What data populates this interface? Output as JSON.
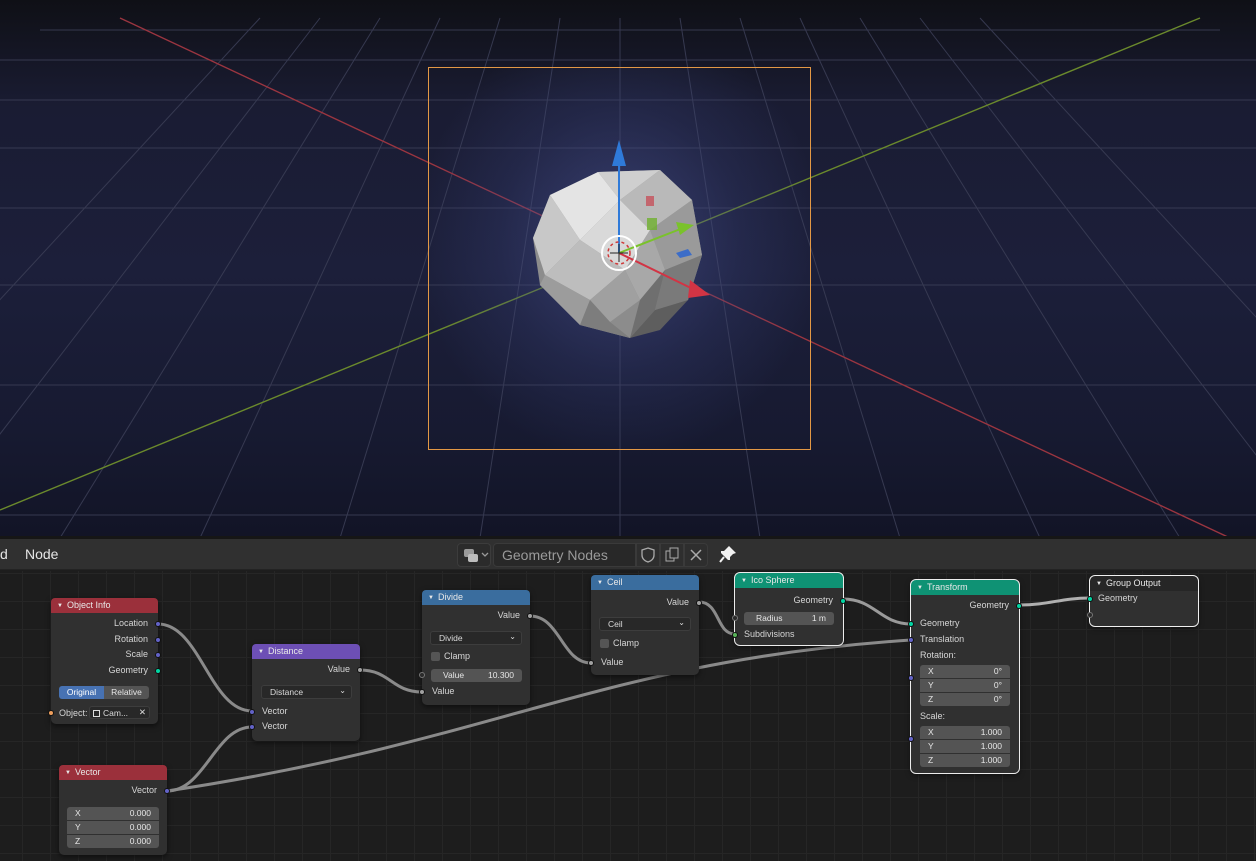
{
  "header": {
    "menu_partial": "d",
    "menu_node": "Node",
    "tree_name_placeholder": "Geometry Nodes",
    "fake_user_icon": "shield-icon",
    "copy_icon": "duplicate-icon",
    "close_icon": "close-icon",
    "pin_icon": "pin-icon"
  },
  "colors": {
    "camera_frame": "#e39845",
    "geometry_socket": "#00d6a3",
    "vector_socket": "#6363c7",
    "value_socket": "#a1a1a1",
    "input_header": "#9b303b",
    "vector_header": "#6d4fb5",
    "math_header": "#3a6d9e",
    "geometry_header": "#0f9274"
  },
  "nodes": {
    "object_info": {
      "title": "Object Info",
      "outputs": [
        "Location",
        "Rotation",
        "Scale",
        "Geometry"
      ],
      "mode_original": "Original",
      "mode_relative": "Relative",
      "object_label": "Object:",
      "object_value": "Cam..."
    },
    "distance": {
      "title": "Distance",
      "output": "Value",
      "operation": "Distance",
      "inputs": [
        "Vector",
        "Vector"
      ]
    },
    "divide": {
      "title": "Divide",
      "output": "Value",
      "operation": "Divide",
      "clamp": "Clamp",
      "value_label": "Value",
      "value": "10.300",
      "input": "Value"
    },
    "ceil": {
      "title": "Ceil",
      "output": "Value",
      "operation": "Ceil",
      "clamp": "Clamp",
      "input": "Value"
    },
    "ico_sphere": {
      "title": "Ico Sphere",
      "output": "Geometry",
      "radius_label": "Radius",
      "radius_value": "1 m",
      "subdivisions": "Subdivisions"
    },
    "transform": {
      "title": "Transform",
      "output": "Geometry",
      "input_geometry": "Geometry",
      "input_translation": "Translation",
      "rotation_label": "Rotation:",
      "rotation": [
        {
          "axis": "X",
          "value": "0°"
        },
        {
          "axis": "Y",
          "value": "0°"
        },
        {
          "axis": "Z",
          "value": "0°"
        }
      ],
      "scale_label": "Scale:",
      "scale": [
        {
          "axis": "X",
          "value": "1.000"
        },
        {
          "axis": "Y",
          "value": "1.000"
        },
        {
          "axis": "Z",
          "value": "1.000"
        }
      ]
    },
    "group_output": {
      "title": "Group Output",
      "input": "Geometry"
    },
    "vector": {
      "title": "Vector",
      "output": "Vector",
      "values": [
        {
          "axis": "X",
          "value": "0.000"
        },
        {
          "axis": "Y",
          "value": "0.000"
        },
        {
          "axis": "Z",
          "value": "0.000"
        }
      ]
    }
  }
}
